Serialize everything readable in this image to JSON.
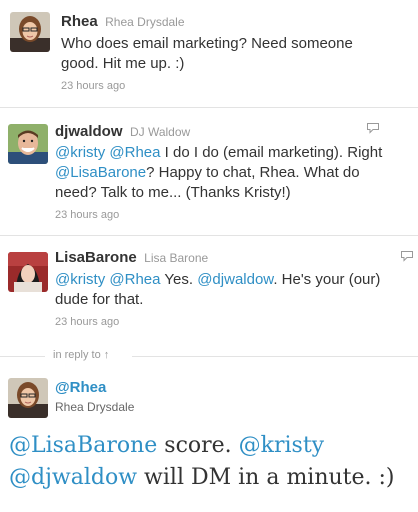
{
  "tweets": [
    {
      "screen_name": "Rhea",
      "full_name": "Rhea Drysdale",
      "text": "Who does email marketing? Need someone good. Hit me up. :)",
      "line1": "Who does email marketing? Need someone",
      "line2": "good. Hit me up. :)",
      "time": "23 hours ago"
    },
    {
      "screen_name": "djwaldow",
      "full_name": "DJ Waldow",
      "m1": "@kristy",
      "m2": "@Rhea",
      "t1": " I do I do (email marketing). Right",
      "m3": "@LisaBarone",
      "t2": "? Happy to chat, Rhea. What do",
      "t3": "need? Talk to me... (Thanks Kristy!)",
      "time": "23 hours ago"
    },
    {
      "screen_name": "LisaBarone",
      "full_name": "Lisa Barone",
      "m1": "@kristy",
      "m2": "@Rhea",
      "t1": " Yes. ",
      "m3": "@djwaldow",
      "t2": ". He's your (our)",
      "t3": "dude for that.",
      "time": "23 hours ago"
    }
  ],
  "in_reply_to": "in reply to ↑",
  "origin": {
    "screen_name": "@Rhea",
    "full_name": "Rhea Drysdale",
    "m1": "@LisaBarone",
    "t1": " score. ",
    "m2": "@kristy",
    "m3": "@djwaldow",
    "t2": " will DM in a minute. :)"
  },
  "colors": {
    "link": "#2f8fc5",
    "text": "#333333",
    "meta": "#999999"
  },
  "icons": {
    "reply": "reply-icon"
  }
}
